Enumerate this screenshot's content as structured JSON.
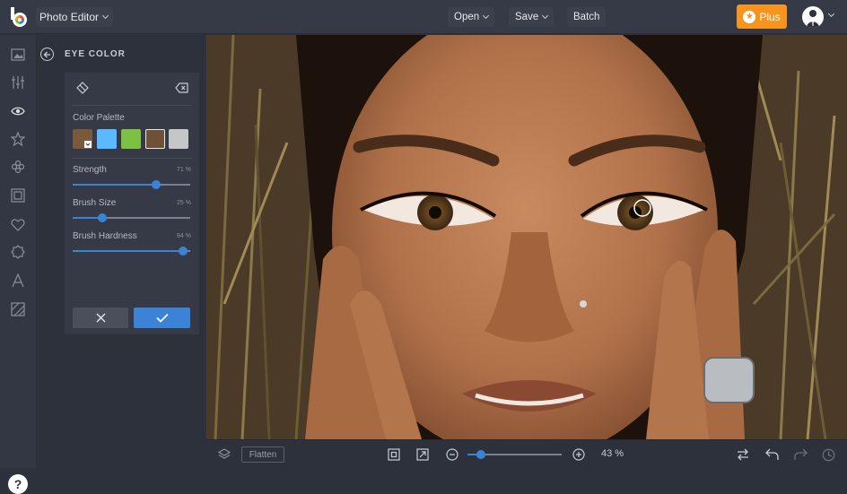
{
  "topbar": {
    "app_menu_label": "Photo Editor",
    "open_label": "Open",
    "save_label": "Save",
    "batch_label": "Batch",
    "plus_label": "Plus"
  },
  "sidebar_tools": [
    "image-icon",
    "sliders-icon",
    "eye-icon",
    "star-icon",
    "flower-icon",
    "frame-icon",
    "heart-icon",
    "badge-icon",
    "text-icon",
    "texture-icon"
  ],
  "panel": {
    "title": "EYE COLOR",
    "color_palette_label": "Color Palette",
    "swatches": [
      "#7a5a3a",
      "#5cb8ff",
      "#7cc142",
      "#6e5238",
      "#c4c6c8"
    ],
    "strength": {
      "label": "Strength",
      "value_text": "71 %",
      "value": 0.71
    },
    "brush_size": {
      "label": "Brush Size",
      "value_text": "25 %",
      "value": 0.25
    },
    "brush_hardness": {
      "label": "Brush Hardness",
      "value_text": "94 %",
      "value": 0.94
    }
  },
  "help_label": "?",
  "bottombar": {
    "flatten_label": "Flatten",
    "zoom_text": "43 %",
    "zoom_value": 0.14
  },
  "colors": {
    "accent": "#3b83d6",
    "plus": "#f7941d",
    "bar": "#363a46",
    "panel": "#2d313c"
  }
}
